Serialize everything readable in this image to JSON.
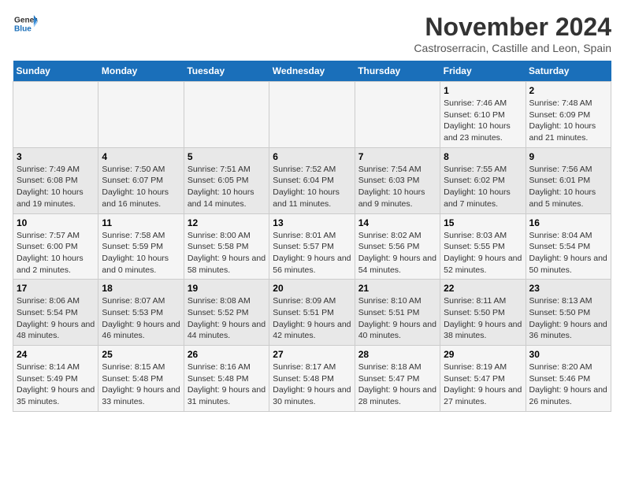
{
  "header": {
    "logo_general": "General",
    "logo_blue": "Blue",
    "title": "November 2024",
    "subtitle": "Castroserracin, Castille and Leon, Spain"
  },
  "weekdays": [
    "Sunday",
    "Monday",
    "Tuesday",
    "Wednesday",
    "Thursday",
    "Friday",
    "Saturday"
  ],
  "weeks": [
    [
      {
        "day": "",
        "info": ""
      },
      {
        "day": "",
        "info": ""
      },
      {
        "day": "",
        "info": ""
      },
      {
        "day": "",
        "info": ""
      },
      {
        "day": "",
        "info": ""
      },
      {
        "day": "1",
        "info": "Sunrise: 7:46 AM\nSunset: 6:10 PM\nDaylight: 10 hours and 23 minutes."
      },
      {
        "day": "2",
        "info": "Sunrise: 7:48 AM\nSunset: 6:09 PM\nDaylight: 10 hours and 21 minutes."
      }
    ],
    [
      {
        "day": "3",
        "info": "Sunrise: 7:49 AM\nSunset: 6:08 PM\nDaylight: 10 hours and 19 minutes."
      },
      {
        "day": "4",
        "info": "Sunrise: 7:50 AM\nSunset: 6:07 PM\nDaylight: 10 hours and 16 minutes."
      },
      {
        "day": "5",
        "info": "Sunrise: 7:51 AM\nSunset: 6:05 PM\nDaylight: 10 hours and 14 minutes."
      },
      {
        "day": "6",
        "info": "Sunrise: 7:52 AM\nSunset: 6:04 PM\nDaylight: 10 hours and 11 minutes."
      },
      {
        "day": "7",
        "info": "Sunrise: 7:54 AM\nSunset: 6:03 PM\nDaylight: 10 hours and 9 minutes."
      },
      {
        "day": "8",
        "info": "Sunrise: 7:55 AM\nSunset: 6:02 PM\nDaylight: 10 hours and 7 minutes."
      },
      {
        "day": "9",
        "info": "Sunrise: 7:56 AM\nSunset: 6:01 PM\nDaylight: 10 hours and 5 minutes."
      }
    ],
    [
      {
        "day": "10",
        "info": "Sunrise: 7:57 AM\nSunset: 6:00 PM\nDaylight: 10 hours and 2 minutes."
      },
      {
        "day": "11",
        "info": "Sunrise: 7:58 AM\nSunset: 5:59 PM\nDaylight: 10 hours and 0 minutes."
      },
      {
        "day": "12",
        "info": "Sunrise: 8:00 AM\nSunset: 5:58 PM\nDaylight: 9 hours and 58 minutes."
      },
      {
        "day": "13",
        "info": "Sunrise: 8:01 AM\nSunset: 5:57 PM\nDaylight: 9 hours and 56 minutes."
      },
      {
        "day": "14",
        "info": "Sunrise: 8:02 AM\nSunset: 5:56 PM\nDaylight: 9 hours and 54 minutes."
      },
      {
        "day": "15",
        "info": "Sunrise: 8:03 AM\nSunset: 5:55 PM\nDaylight: 9 hours and 52 minutes."
      },
      {
        "day": "16",
        "info": "Sunrise: 8:04 AM\nSunset: 5:54 PM\nDaylight: 9 hours and 50 minutes."
      }
    ],
    [
      {
        "day": "17",
        "info": "Sunrise: 8:06 AM\nSunset: 5:54 PM\nDaylight: 9 hours and 48 minutes."
      },
      {
        "day": "18",
        "info": "Sunrise: 8:07 AM\nSunset: 5:53 PM\nDaylight: 9 hours and 46 minutes."
      },
      {
        "day": "19",
        "info": "Sunrise: 8:08 AM\nSunset: 5:52 PM\nDaylight: 9 hours and 44 minutes."
      },
      {
        "day": "20",
        "info": "Sunrise: 8:09 AM\nSunset: 5:51 PM\nDaylight: 9 hours and 42 minutes."
      },
      {
        "day": "21",
        "info": "Sunrise: 8:10 AM\nSunset: 5:51 PM\nDaylight: 9 hours and 40 minutes."
      },
      {
        "day": "22",
        "info": "Sunrise: 8:11 AM\nSunset: 5:50 PM\nDaylight: 9 hours and 38 minutes."
      },
      {
        "day": "23",
        "info": "Sunrise: 8:13 AM\nSunset: 5:50 PM\nDaylight: 9 hours and 36 minutes."
      }
    ],
    [
      {
        "day": "24",
        "info": "Sunrise: 8:14 AM\nSunset: 5:49 PM\nDaylight: 9 hours and 35 minutes."
      },
      {
        "day": "25",
        "info": "Sunrise: 8:15 AM\nSunset: 5:48 PM\nDaylight: 9 hours and 33 minutes."
      },
      {
        "day": "26",
        "info": "Sunrise: 8:16 AM\nSunset: 5:48 PM\nDaylight: 9 hours and 31 minutes."
      },
      {
        "day": "27",
        "info": "Sunrise: 8:17 AM\nSunset: 5:48 PM\nDaylight: 9 hours and 30 minutes."
      },
      {
        "day": "28",
        "info": "Sunrise: 8:18 AM\nSunset: 5:47 PM\nDaylight: 9 hours and 28 minutes."
      },
      {
        "day": "29",
        "info": "Sunrise: 8:19 AM\nSunset: 5:47 PM\nDaylight: 9 hours and 27 minutes."
      },
      {
        "day": "30",
        "info": "Sunrise: 8:20 AM\nSunset: 5:46 PM\nDaylight: 9 hours and 26 minutes."
      }
    ]
  ]
}
